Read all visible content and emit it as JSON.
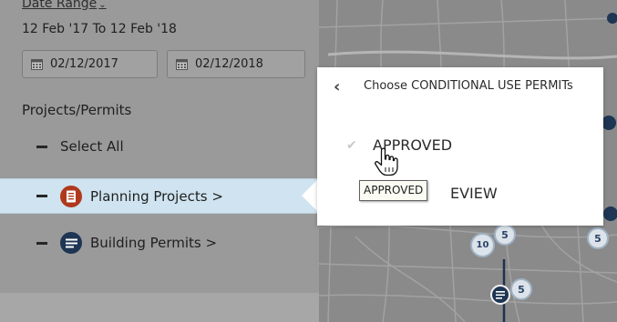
{
  "sidebar": {
    "date_range_label": "Date Range",
    "date_range_chevron": "⌄",
    "date_range_text": "12 Feb '17 To 12 Feb '18",
    "date_from": "02/12/2017",
    "date_to": "02/12/2018",
    "section_heading": "Projects/Permits",
    "items": [
      {
        "label": "Select All"
      },
      {
        "label": "Planning Projects",
        "chevron": ">",
        "icon": "document-icon",
        "icon_color": "#b0391d",
        "selected": true
      },
      {
        "label": "Building Permits",
        "chevron": ">",
        "icon": "list-icon",
        "icon_color": "#1e3553"
      }
    ]
  },
  "popover": {
    "back_icon": "chevron-left-icon",
    "title": "Choose CONDITIONAL USE PERMITs",
    "options": [
      {
        "label": "APPROVED",
        "checked": true
      },
      {
        "label": "UNDER REVIEW",
        "visible_text": "EVIEW",
        "checked": false
      }
    ]
  },
  "tooltip": {
    "text": "APPROVED"
  },
  "map": {
    "markers": [
      {
        "label": "5"
      },
      {
        "label": "5"
      },
      {
        "label": "10"
      },
      {
        "label": "5"
      }
    ]
  },
  "colors": {
    "selected_row": "#cfe3f0",
    "planning_icon": "#b0391d",
    "building_icon": "#1e3553"
  }
}
